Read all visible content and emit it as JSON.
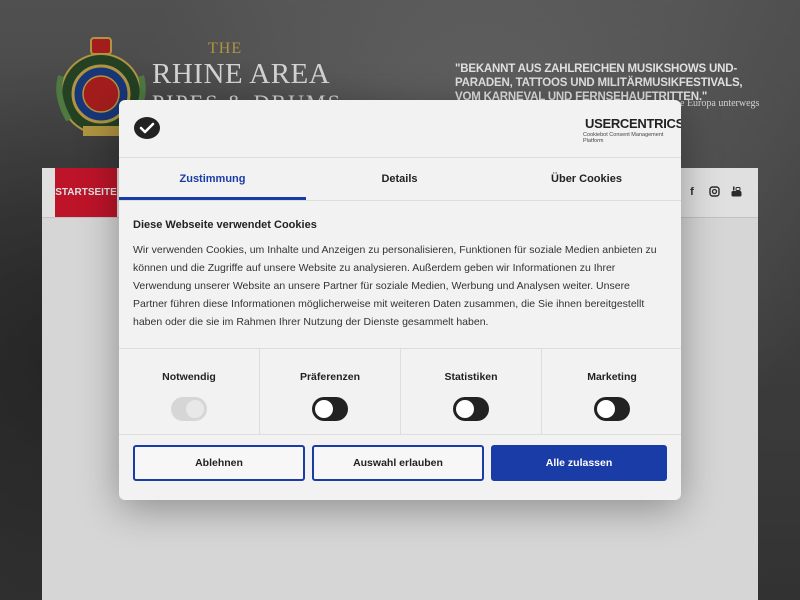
{
  "site": {
    "brand_the": "THE",
    "brand_name": "RHINE AREA",
    "brand_sub": "PIPES & DRUMS",
    "quote": "\"BEKANNT AUS ZAHLREICHEN MUSIKSHOWS UND-PARADEN, TATTOOS UND MILITÄRMUSIKFESTIVALS, VOM KARNEVAL UND FERNSEHAUFTRITTEN.\"",
    "tagline": "e Europa unterwegs",
    "nav_home": "STARTSEITE",
    "social_icons": [
      "facebook-icon",
      "instagram-icon",
      "youtube-icon"
    ]
  },
  "consent": {
    "provider_title": "USERCENTRICS",
    "provider_sub": "Cookiebot Consent Management Platform",
    "tabs": [
      {
        "label": "Zustimmung",
        "active": true
      },
      {
        "label": "Details",
        "active": false
      },
      {
        "label": "Über Cookies",
        "active": false
      }
    ],
    "heading": "Diese Webseite verwendet Cookies",
    "text": "Wir verwenden Cookies, um Inhalte und Anzeigen zu personalisieren, Funktionen für soziale Medien anbieten zu können und die Zugriffe auf unsere Website zu analysieren. Außerdem geben wir Informationen zu Ihrer Verwendung unserer Website an unsere Partner für soziale Medien, Werbung und Analysen weiter. Unsere Partner führen diese Informationen möglicherweise mit weiteren Daten zusammen, die Sie ihnen bereitgestellt haben oder die sie im Rahmen Ihrer Nutzung der Dienste gesammelt haben.",
    "categories": [
      {
        "label": "Notwendig",
        "enabled": true,
        "locked": true
      },
      {
        "label": "Präferenzen",
        "enabled": false,
        "locked": false
      },
      {
        "label": "Statistiken",
        "enabled": false,
        "locked": false
      },
      {
        "label": "Marketing",
        "enabled": false,
        "locked": false
      }
    ],
    "buttons": {
      "reject": "Ablehnen",
      "allow_selection": "Auswahl erlauben",
      "allow_all": "Alle zulassen"
    },
    "colors": {
      "accent": "#1a3ca6",
      "nav_red": "#d8172f"
    }
  }
}
